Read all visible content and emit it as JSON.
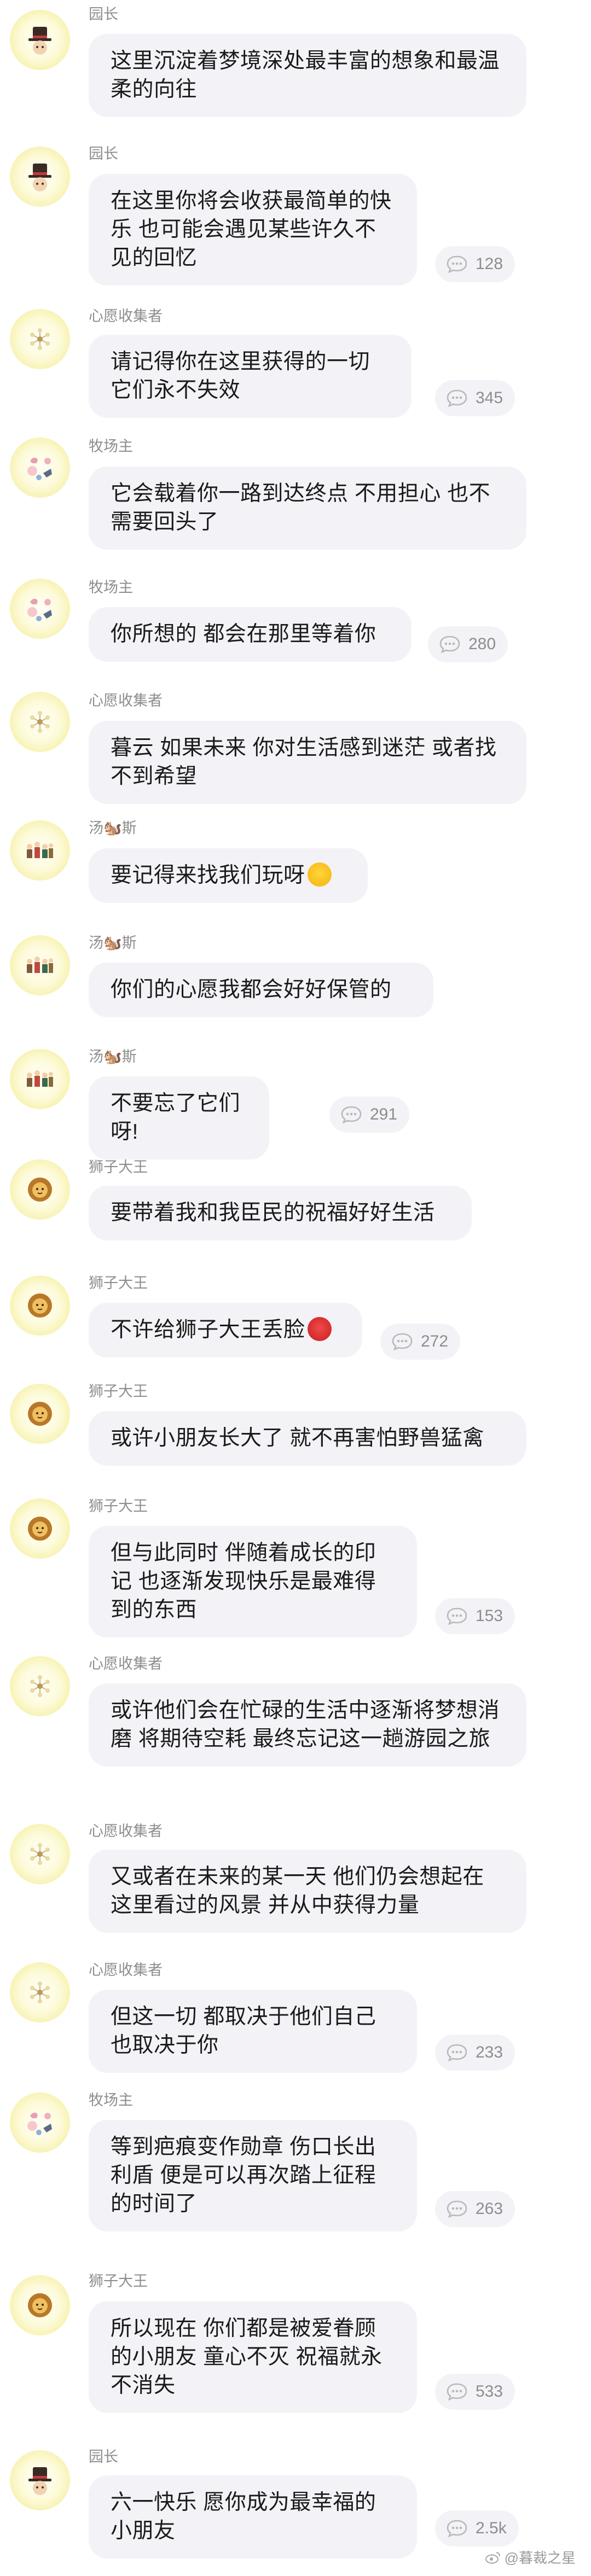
{
  "names": {
    "yuanzhang": "园长",
    "xinyuan": "心愿收集者",
    "muchang": "牧场主",
    "tangmusi": "汤🐿️斯",
    "shizi": "狮子大王"
  },
  "messages": [
    {
      "text": "这里沉淀着梦境深处最丰富的想象和最温柔的向往"
    },
    {
      "text": "在这里你将会收获最简单的快乐 也可能会遇见某些许久不见的回忆",
      "comments": "128"
    },
    {
      "text": "请记得你在这里获得的一切 它们永不失效",
      "comments": "345"
    },
    {
      "text": "它会载着你一路到达终点 不用担心 也不需要回头了"
    },
    {
      "text": "你所想的 都会在那里等着你",
      "comments": "280"
    },
    {
      "text": "暮云 如果未来 你对生活感到迷茫 或者找不到希望"
    },
    {
      "text": "要记得来找我们玩呀"
    },
    {
      "text": "你们的心愿我都会好好保管的"
    },
    {
      "text": "不要忘了它们呀!",
      "comments": "291"
    },
    {
      "text": "要带着我和我臣民的祝福好好生活"
    },
    {
      "text": "不许给狮子大王丢脸",
      "comments": "272"
    },
    {
      "text": "或许小朋友长大了 就不再害怕野兽猛禽"
    },
    {
      "text": "但与此同时 伴随着成长的印记 也逐渐发现快乐是最难得到的东西",
      "comments": "153"
    },
    {
      "text": "或许他们会在忙碌的生活中逐渐将梦想消磨 将期待空耗 最终忘记这一趟游园之旅"
    },
    {
      "text": "又或者在未来的某一天 他们仍会想起在这里看过的风景 并从中获得力量"
    },
    {
      "text": "但这一切 都取决于他们自己 也取决于你",
      "comments": "233"
    },
    {
      "text": "等到疤痕变作勋章 伤口长出利盾 便是可以再次踏上征程的时间了",
      "comments": "263"
    },
    {
      "text": "所以现在 你们都是被爱眷顾的小朋友 童心不灭 祝福就永不消失",
      "comments": "533"
    },
    {
      "text": "六一快乐 愿你成为最幸福的小朋友",
      "comments": "2.5k"
    }
  ],
  "watermark": "@暮裁之星",
  "colors": {
    "avatar_ring": "#f2ea90",
    "bubble": "#f3f3f7",
    "name": "#8d8d8d"
  }
}
